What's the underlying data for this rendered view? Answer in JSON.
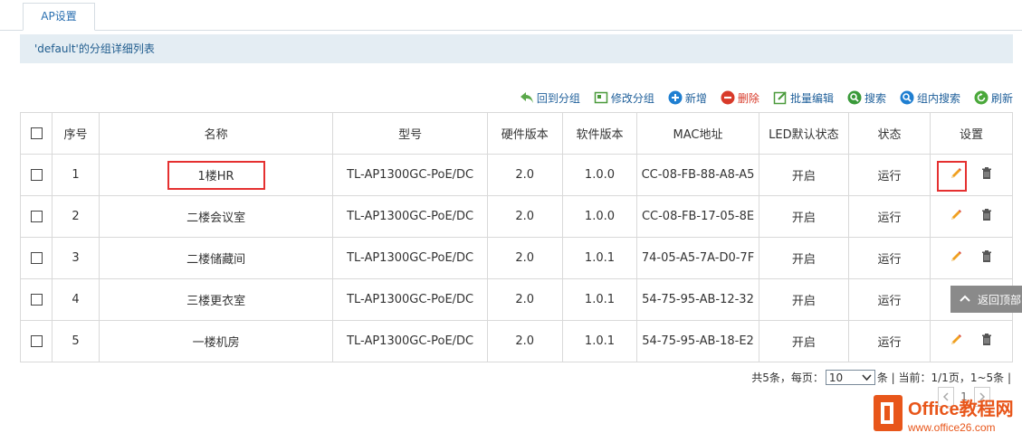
{
  "tab": {
    "label": "AP设置"
  },
  "banner": {
    "text": "'default'的分组详细列表"
  },
  "toolbar": {
    "back": "回到分组",
    "edit_group": "修改分组",
    "add": "新增",
    "delete": "删除",
    "batch_edit": "批量编辑",
    "search": "搜索",
    "group_search": "组内搜索",
    "refresh": "刷新"
  },
  "table": {
    "headers": [
      "序号",
      "名称",
      "型号",
      "硬件版本",
      "软件版本",
      "MAC地址",
      "LED默认状态",
      "状态",
      "设置"
    ],
    "rows": [
      {
        "index": "1",
        "name": "1楼HR",
        "model": "TL-AP1300GC-PoE/DC",
        "hw": "2.0",
        "sw": "1.0.0",
        "mac": "CC-08-FB-88-A8-A5",
        "led": "开启",
        "status": "运行"
      },
      {
        "index": "2",
        "name": "二楼会议室",
        "model": "TL-AP1300GC-PoE/DC",
        "hw": "2.0",
        "sw": "1.0.0",
        "mac": "CC-08-FB-17-05-8E",
        "led": "开启",
        "status": "运行"
      },
      {
        "index": "3",
        "name": "二楼储藏间",
        "model": "TL-AP1300GC-PoE/DC",
        "hw": "2.0",
        "sw": "1.0.1",
        "mac": "74-05-A5-7A-D0-7F",
        "led": "开启",
        "status": "运行"
      },
      {
        "index": "4",
        "name": "三楼更衣室",
        "model": "TL-AP1300GC-PoE/DC",
        "hw": "2.0",
        "sw": "1.0.1",
        "mac": "54-75-95-AB-12-32",
        "led": "开启",
        "status": "运行"
      },
      {
        "index": "5",
        "name": "一楼机房",
        "model": "TL-AP1300GC-PoE/DC",
        "hw": "2.0",
        "sw": "1.0.1",
        "mac": "54-75-95-AB-18-E2",
        "led": "开启",
        "status": "运行"
      }
    ]
  },
  "back_to_top": "返回顶部",
  "pagination": {
    "total": "共5条，每页：",
    "page_size": "10",
    "current": "条 | 当前：1/1页，1~5条 |",
    "page_num": "1"
  },
  "watermark": {
    "brand": "Office教程网",
    "url": "www.office26.com"
  },
  "colors": {
    "accent": "#1e5f9a",
    "highlight": "#e53030",
    "banner_bg": "#e4edf3"
  }
}
